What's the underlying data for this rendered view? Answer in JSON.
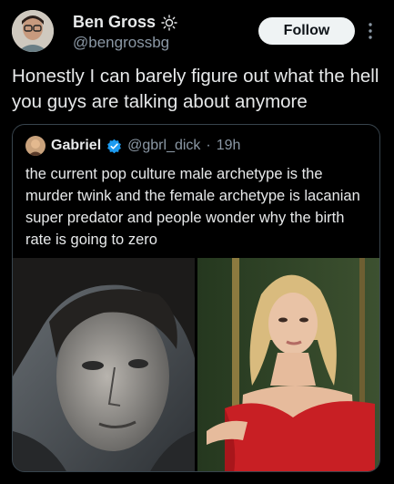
{
  "author": {
    "name": "Ben Gross",
    "name_emoji": "sun-emoji",
    "handle": "@bengrossbg"
  },
  "follow_label": "Follow",
  "tweet_text": "Honestly I can barely figure out what the hell you guys are talking about anymore",
  "quoted": {
    "name": "Gabriel",
    "verified_icon": "verified-badge-icon",
    "handle": "@gbrl_dick",
    "separator": "·",
    "time": "19h",
    "text": "the current pop culture male archetype is the murder twink and the female archetype is lacanian super predator and people wonder why the birth rate is going to zero"
  },
  "colors": {
    "background": "#000000",
    "text": "#e7e9ea",
    "secondary_text": "#8b98a5",
    "border": "#38444d",
    "verified": "#1d9bf0",
    "follow_bg": "#eff3f4"
  }
}
